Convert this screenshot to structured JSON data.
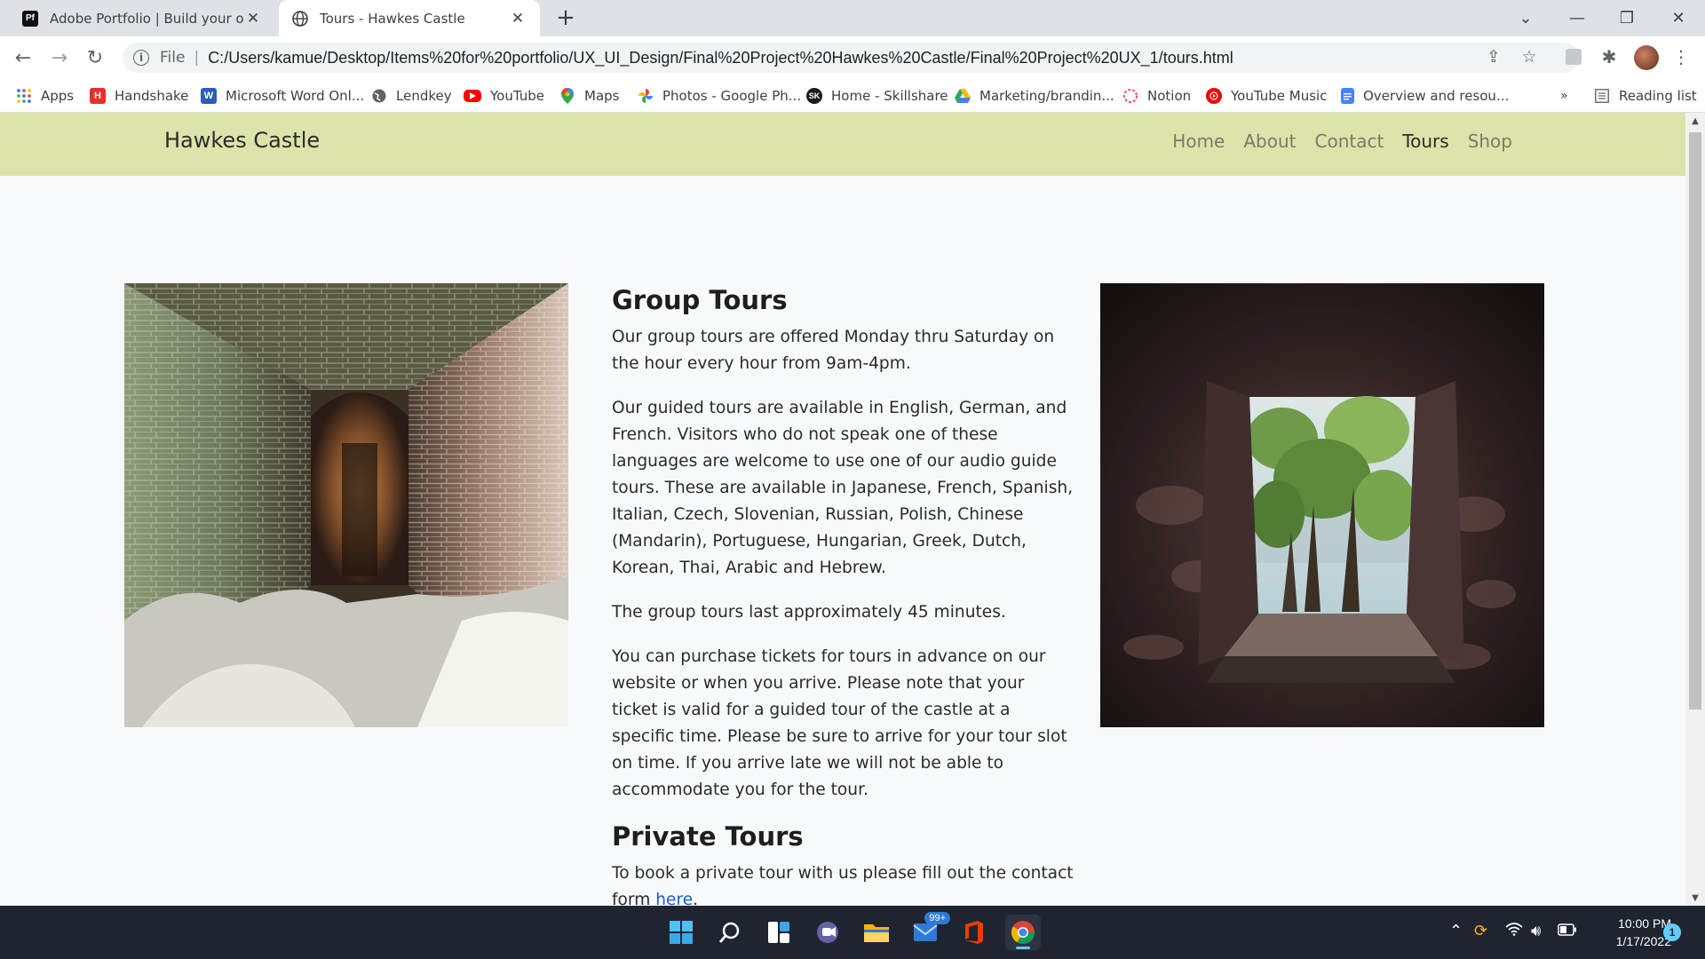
{
  "browser": {
    "tabs": [
      {
        "title": "Adobe Portfolio | Build your own",
        "favicon": "Pf",
        "active": false
      },
      {
        "title": "Tours - Hawkes Castle",
        "favicon": "globe-icon",
        "active": true
      }
    ],
    "new_tab": "+",
    "address": {
      "scheme_label": "File",
      "url": "C:/Users/kamue/Desktop/Items%20for%20portfolio/UX_UI_Design/Final%20Project%20Hawkes%20Castle/Final%20Project%20UX_1/tours.html"
    },
    "bookmarks": [
      {
        "label": "Apps",
        "icon": "apps-grid-icon"
      },
      {
        "label": "Handshake",
        "icon": "H"
      },
      {
        "label": "Microsoft Word Onl...",
        "icon": "W"
      },
      {
        "label": "Lendkey",
        "icon": "globe-icon"
      },
      {
        "label": "YouTube",
        "icon": "youtube-icon"
      },
      {
        "label": "Maps",
        "icon": "maps-pin-icon"
      },
      {
        "label": "Photos - Google Ph...",
        "icon": "photos-pinwheel-icon"
      },
      {
        "label": "Home - Skillshare",
        "icon": "SK"
      },
      {
        "label": "Marketing/brandin...",
        "icon": "drive-icon"
      },
      {
        "label": "Notion",
        "icon": "notion-icon"
      },
      {
        "label": "YouTube Music",
        "icon": "youtube-music-icon"
      },
      {
        "label": "Overview and resou...",
        "icon": "docs-icon"
      }
    ],
    "more_bookmarks": "»",
    "reading_list": "Reading list",
    "colors": {
      "tabstrip": "#dee1e6",
      "toolbar": "#ffffff"
    }
  },
  "site": {
    "brand": "Hawkes Castle",
    "nav": [
      {
        "label": "Home",
        "current": false
      },
      {
        "label": "About",
        "current": false
      },
      {
        "label": "Contact",
        "current": false
      },
      {
        "label": "Tours",
        "current": true
      },
      {
        "label": "Shop",
        "current": false
      }
    ],
    "colors": {
      "nav_bg": "#dde3a9",
      "link": "#1a5fd6"
    },
    "group_tours": {
      "heading": "Group Tours",
      "p1": "Our group tours are offered Monday thru Saturday on the hour every hour from 9am-4pm.",
      "p2": "Our guided tours are available in English, German, and French. Visitors who do not speak one of these languages are welcome to use one of our audio guide tours. These are available in Japanese, French, Spanish, Italian, Czech, Slovenian, Russian, Polish, Chinese (Mandarin), Portuguese, Hungarian, Greek, Dutch, Korean, Thai, Arabic and Hebrew.",
      "p3": "The group tours last approximately 45 minutes.",
      "p4": "You can purchase tickets for tours in advance on our website or when you arrive. Please note that your ticket is valid for a guided tour of the castle at a specific time. Please be sure to arrive for your tour slot on time. If you arrive late we will not be able to accommodate you for the tour."
    },
    "private_tours": {
      "heading": "Private Tours",
      "text_before": "To book a private tour with us please fill out the contact form ",
      "link": "here",
      "text_after": "."
    }
  },
  "taskbar": {
    "mail_badge": "99+",
    "time": "10:00 PM",
    "date": "1/17/2022",
    "notifications": "1"
  }
}
